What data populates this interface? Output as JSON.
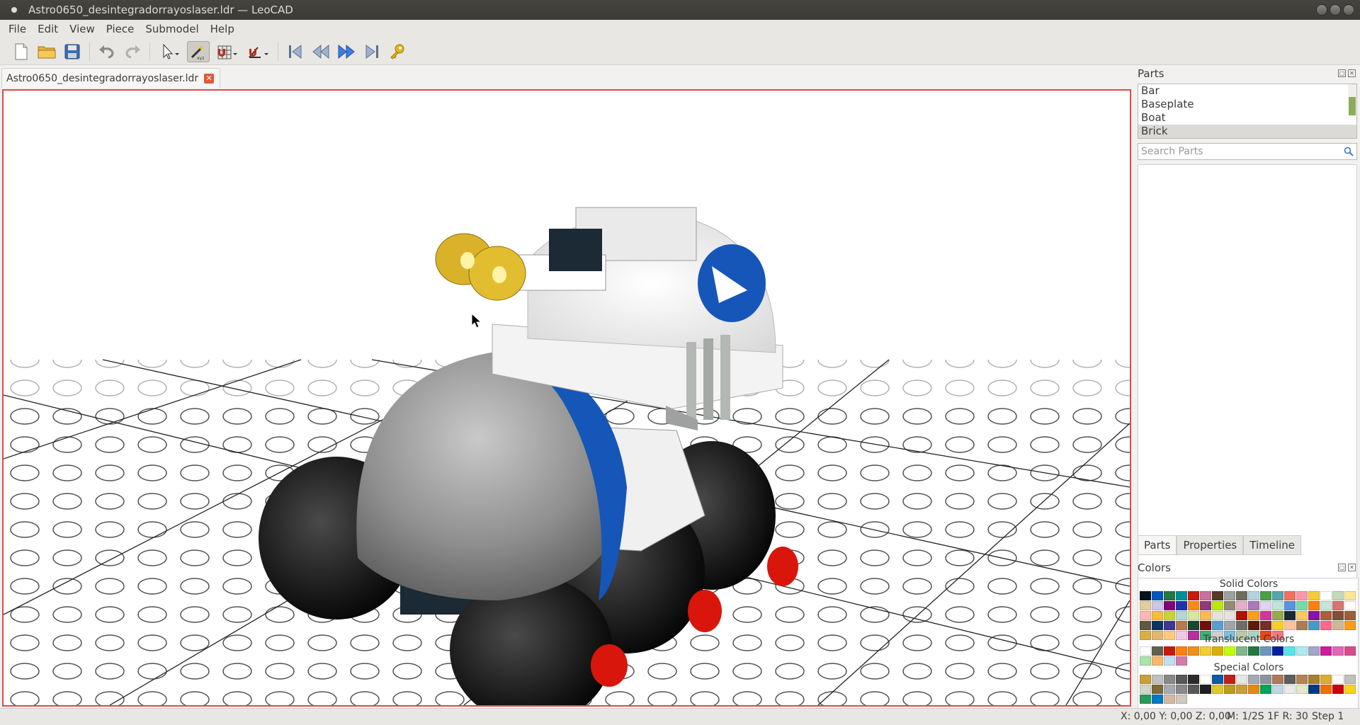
{
  "window": {
    "title": "Astro0650_desintegradorrayoslaser.ldr — LeoCAD"
  },
  "menu": {
    "file": "File",
    "edit": "Edit",
    "view": "View",
    "piece": "Piece",
    "submodel": "Submodel",
    "help": "Help"
  },
  "tab": {
    "label": "Astro0650_desintegradorrayoslaser.ldr"
  },
  "parts_panel": {
    "title": "Parts",
    "categories": [
      "Bar",
      "Baseplate",
      "Boat",
      "Brick"
    ],
    "selected_category": "Brick",
    "search_placeholder": "Search Parts"
  },
  "panel_tabs": {
    "parts": "Parts",
    "properties": "Properties",
    "timeline": "Timeline"
  },
  "colors_panel": {
    "title": "Colors",
    "solid_label": "Solid Colors",
    "translucent_label": "Translucent Colors",
    "special_label": "Special Colors",
    "solid": [
      "#05131d",
      "#0055bf",
      "#237841",
      "#008f9b",
      "#c91a09",
      "#c870a0",
      "#583927",
      "#9ba19d",
      "#6d6e5c",
      "#b4d2e3",
      "#4b9f4a",
      "#55a5af",
      "#f2705e",
      "#fc97ac",
      "#f2cd37",
      "#ffffff",
      "#c2dab8",
      "#fbe696",
      "#e4cd9e",
      "#c9cae2",
      "#81007b",
      "#2032b0",
      "#fe8a18",
      "#923978",
      "#bbe90b",
      "#958a73",
      "#e4adc8",
      "#ac78ba",
      "#e1d5ed",
      "#c0e4da",
      "#5a93db",
      "#73dcaa",
      "#ff800d",
      "#c6e4dc",
      "#d67572",
      "#fcfcfc",
      "#ffb7b5",
      "#f8bb3d",
      "#c7d23c",
      "#b3d7d1",
      "#d9e4a7",
      "#f9ba61",
      "#e6e3da",
      "#e6e3e0",
      "#b31004",
      "#fa9c1c",
      "#d3359d",
      "#9baa49",
      "#1b2a34",
      "#fac864",
      "#8a12a8",
      "#ab6038",
      "#7c503a",
      "#9c5f37",
      "#62583e",
      "#0a3463",
      "#3f3691",
      "#b67b50",
      "#184632",
      "#720e0f",
      "#5c9dd1",
      "#a0a5a9",
      "#6c6e68",
      "#5c1d0d",
      "#733123",
      "#f4d12a",
      "#fec2a3",
      "#aa7d55",
      "#469bc3",
      "#ff698f",
      "#cdb998",
      "#fa9c1c",
      "#d9ae42",
      "#e5b76a",
      "#ffcb78",
      "#f2c7e4",
      "#b72ea0",
      "#3cb371",
      "#cdd0d0",
      "#7dbfdd",
      "#b9c9a5",
      "#aad4c2",
      "#ec4612",
      "#f17880"
    ],
    "translucent": [
      "#fcfcfc",
      "#635f52",
      "#c91a09",
      "#ff800d",
      "#f08f1c",
      "#f5cd2f",
      "#dab000",
      "#c0ff00",
      "#84b68d",
      "#237841",
      "#6c96bf",
      "#0020a0",
      "#56e6e6",
      "#aee9ef",
      "#a5a5cb",
      "#ce1d9b",
      "#df66b8",
      "#da4b8c",
      "#aae3ad",
      "#fcb76d",
      "#c1dff0",
      "#d27ba9"
    ],
    "special": [
      "#c79f3c",
      "#c0c0c0",
      "#898788",
      "#575857",
      "#2c2c2c",
      "#ffffff",
      "#0b5ba7",
      "#c31e1e",
      "#e6e6e6",
      "#a5a9b4",
      "#8d949c",
      "#ae7a59",
      "#605e5c",
      "#b48455",
      "#aa7f2e",
      "#dbac34",
      "#fcfcfc",
      "#c0c0c0",
      "#d4d5c9",
      "#7c6a3d",
      "#a5a9b4",
      "#898788",
      "#575857",
      "#1f1f1f",
      "#ddc829",
      "#bd9a22",
      "#c79f3c",
      "#e28a17",
      "#00a45a",
      "#bfd7e1",
      "#eaeaea",
      "#e3e9c8",
      "#00397d",
      "#ee7000",
      "#c90012",
      "#fad11e",
      "#2a9a58",
      "#0079c2",
      "#d3b9a2",
      "#d0c9bc"
    ]
  },
  "status": {
    "coords": "X: 0,00 Y: 0,00 Z: 0,00",
    "mode": "M: 1/2S 1F R: 30",
    "step": "Step 1"
  }
}
